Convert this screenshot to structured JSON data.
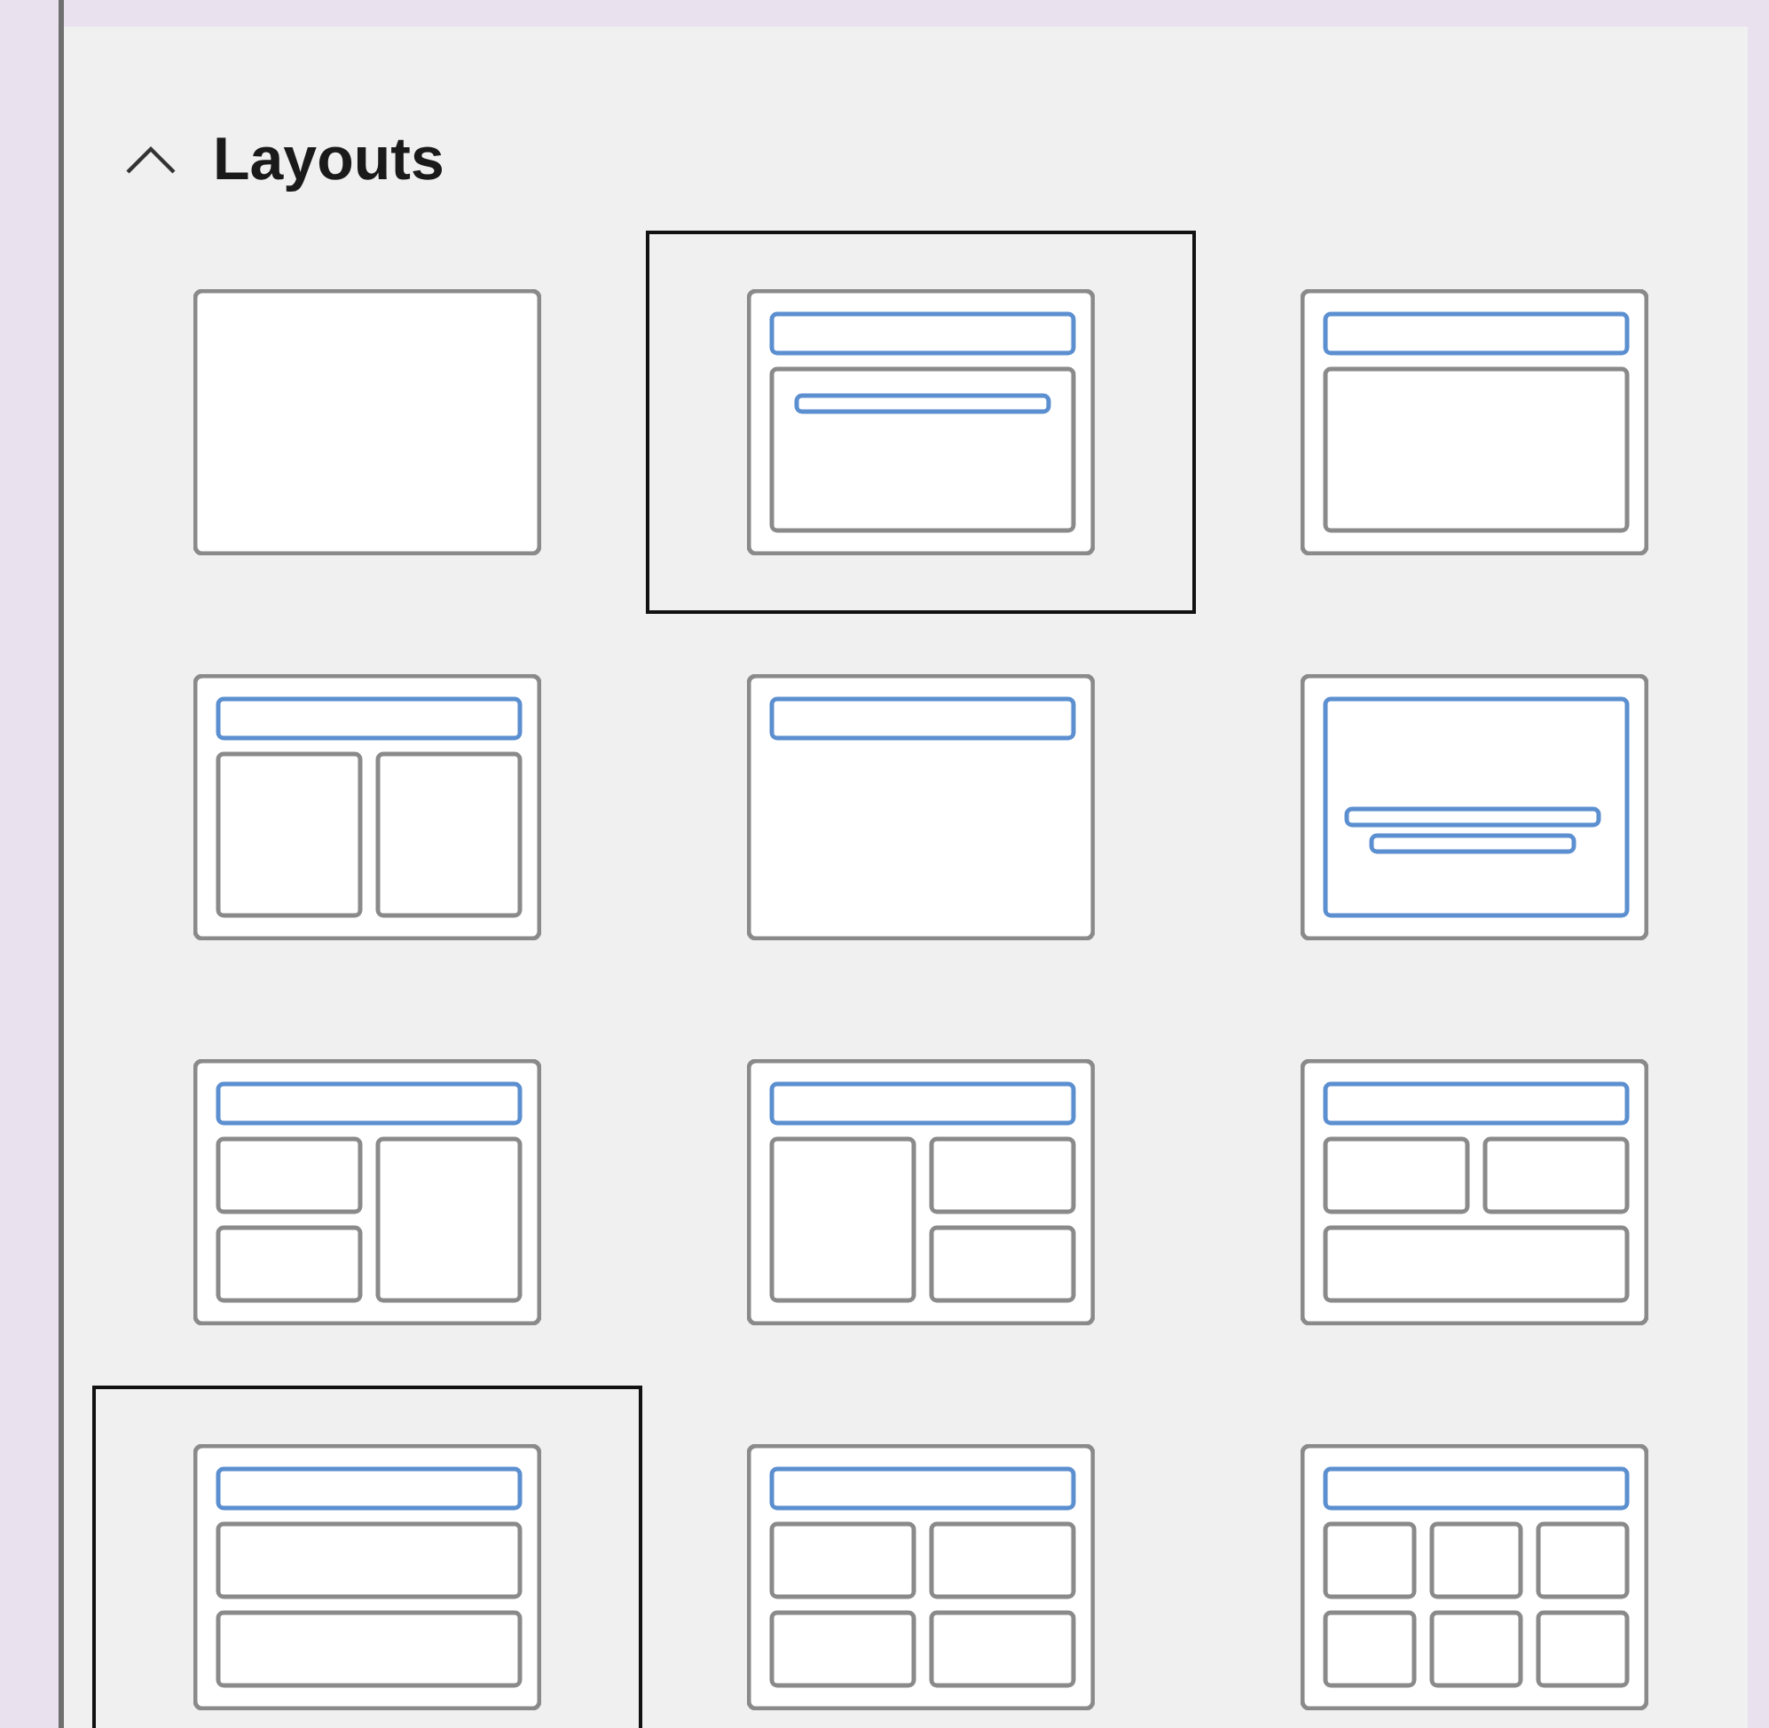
{
  "panel": {
    "title": "Layouts",
    "expanded": true
  },
  "layouts": [
    {
      "kind": "blank",
      "selected": false
    },
    {
      "kind": "title-subtitle",
      "selected": true
    },
    {
      "kind": "title-content",
      "selected": false
    },
    {
      "kind": "title-2content",
      "selected": false
    },
    {
      "kind": "title-only",
      "selected": false
    },
    {
      "kind": "centered-text",
      "selected": false
    },
    {
      "kind": "title-2content-left-split",
      "selected": false
    },
    {
      "kind": "title-2content-right-split",
      "selected": false
    },
    {
      "kind": "title-2content-over-content",
      "selected": false
    },
    {
      "kind": "title-content-over-content",
      "selected": true
    },
    {
      "kind": "title-4content",
      "selected": false
    },
    {
      "kind": "title-6content",
      "selected": false
    }
  ]
}
